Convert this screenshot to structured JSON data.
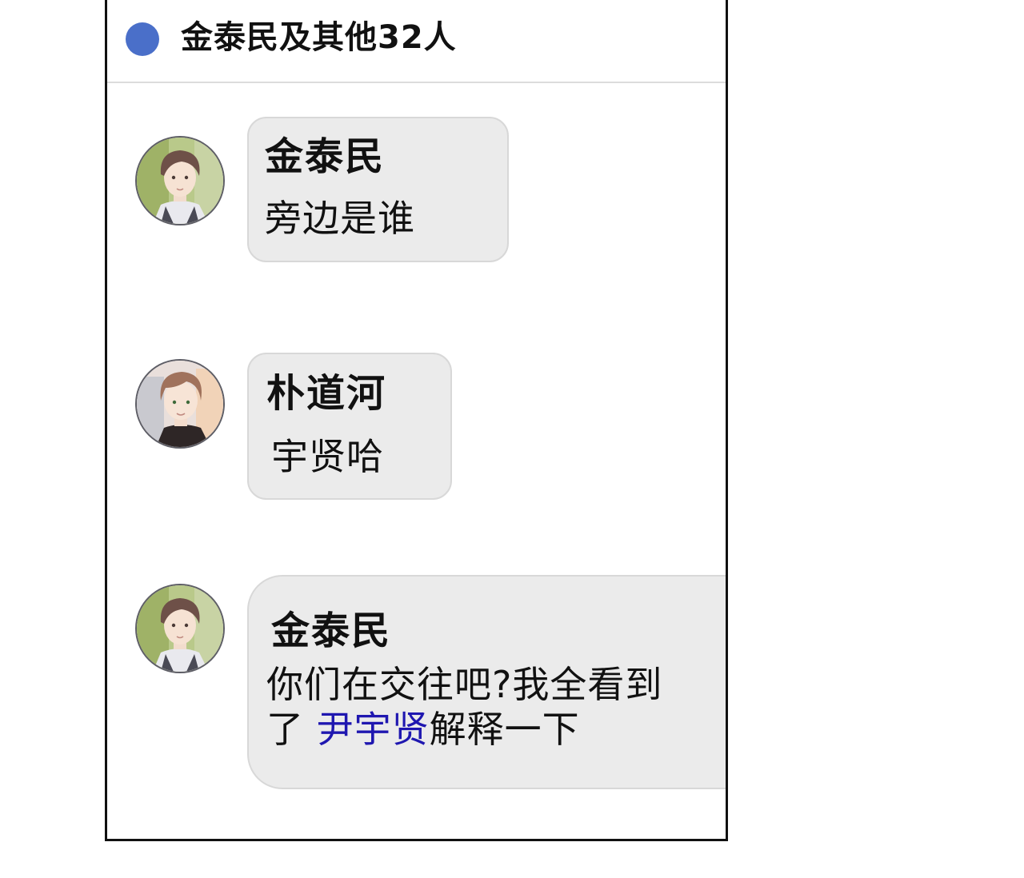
{
  "chat": {
    "title": "金泰民及其他32人",
    "indicator_color": "#4a6fc9"
  },
  "messages": [
    {
      "sender": "金泰民",
      "avatar_icon": "user-avatar-taemin",
      "text": "旁边是谁"
    },
    {
      "sender": "朴道河",
      "avatar_icon": "user-avatar-doha",
      "text": "宇贤哈"
    },
    {
      "sender": "金泰民",
      "avatar_icon": "user-avatar-taemin",
      "line1": "你们在交往吧?我全看到",
      "line2_prefix": "了 ",
      "mention": "尹宇贤",
      "line2_suffix": "解释一下",
      "mention_color": "#1f17b0"
    }
  ]
}
